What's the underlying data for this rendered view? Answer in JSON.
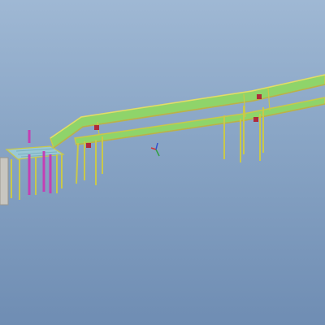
{
  "viewport": {
    "name": "3d-model-viewport",
    "background_top": "#9fb8d4",
    "background_bottom": "#6f8db3"
  },
  "model": {
    "description_colors": {
      "deck": "#8fd46a",
      "frame": "#c9c84a",
      "leg": "#b9b25a",
      "column": "#c43fb4",
      "motor": "#b02a3a",
      "concrete": "#c8c6c0"
    }
  },
  "triad": {
    "icon": "coordinate-triad-icon",
    "x_color": "#d43030",
    "y_color": "#30a040",
    "z_color": "#3050d0"
  }
}
